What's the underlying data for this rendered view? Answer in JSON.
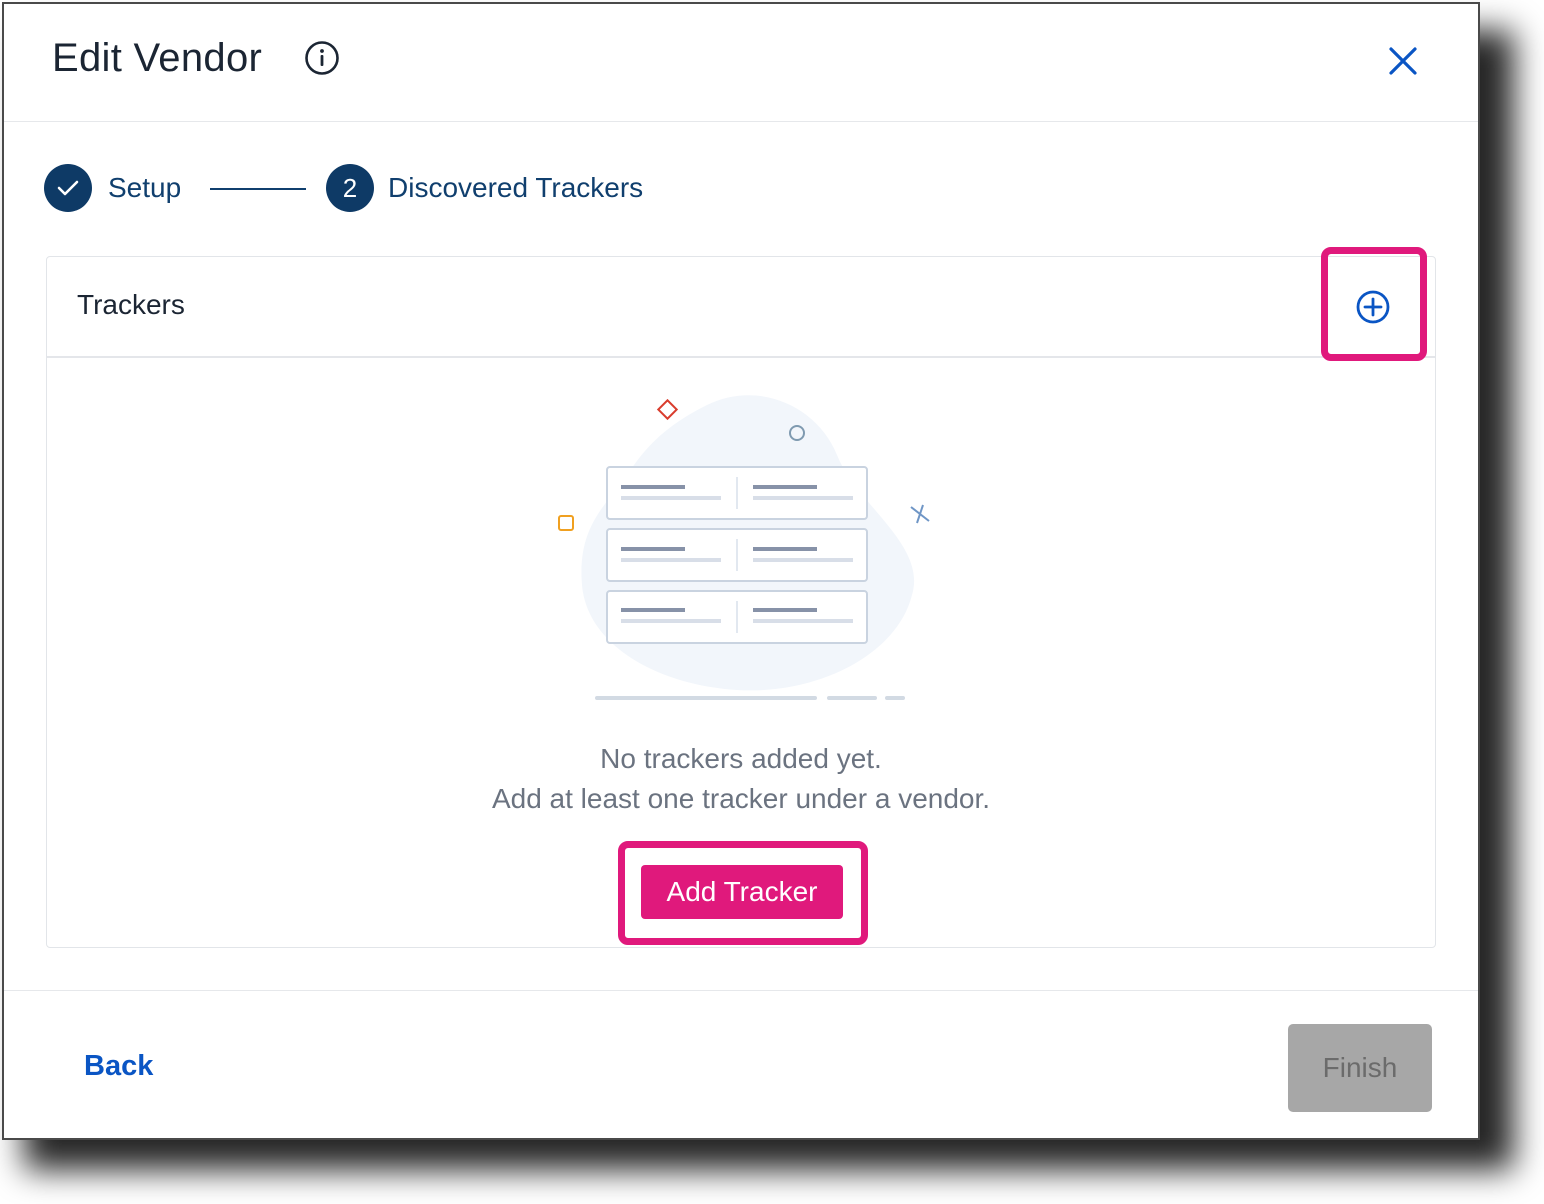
{
  "dialog": {
    "title": "Edit Vendor",
    "info_icon": "info-circle-icon",
    "close_icon": "close-x-icon"
  },
  "stepper": {
    "steps": [
      {
        "label": "Setup",
        "state": "completed",
        "indicator": "check-icon"
      },
      {
        "label": "Discovered Trackers",
        "state": "active",
        "number": "2"
      }
    ]
  },
  "trackers_panel": {
    "title": "Trackers",
    "add_icon": "plus-circle-icon",
    "empty_message_line1": "No trackers added yet.",
    "empty_message_line2": "Add at least one tracker under a vendor.",
    "add_button_label": "Add Tracker"
  },
  "footer": {
    "back_label": "Back",
    "finish_label": "Finish",
    "finish_disabled": true
  },
  "colors": {
    "primary_navy": "#0e3a66",
    "link_blue": "#0a55c4",
    "accent_pink": "#e0197c",
    "disabled_gray": "#a7a7a7"
  }
}
